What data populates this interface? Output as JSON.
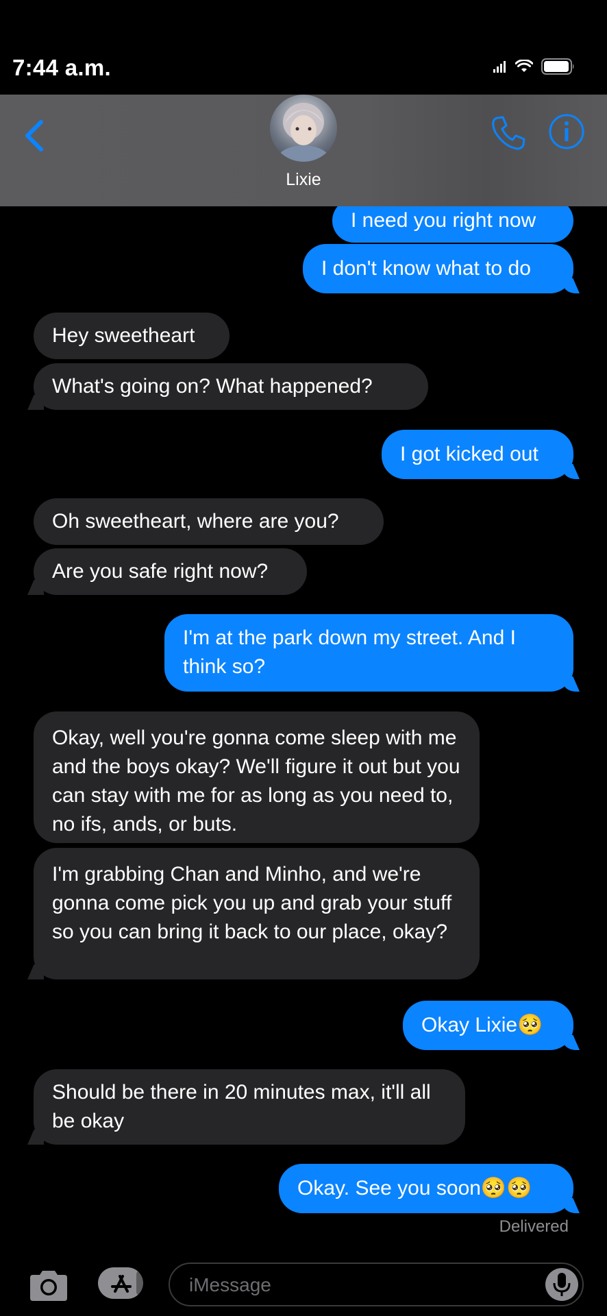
{
  "status_bar": {
    "time": "7:44 a.m."
  },
  "header": {
    "contact_name": "Lixie"
  },
  "messages": [
    {
      "text": "I need you right now"
    },
    {
      "text": "I don't know what to do"
    },
    {
      "text": "Hey sweetheart"
    },
    {
      "text": "What's going on? What happened?"
    },
    {
      "text": "I got kicked out"
    },
    {
      "text": "Oh sweetheart, where are you?"
    },
    {
      "text": "Are you safe right now?"
    },
    {
      "text": "I'm at the park down my street. And I think so?"
    },
    {
      "text": "Okay, well you're gonna come sleep with me and the boys okay? We'll figure it out but you can stay with me for as long as you need to, no ifs, ands, or buts."
    },
    {
      "text": "I'm grabbing Chan and Minho, and we're gonna come pick you up and grab your stuff so you can bring it back to our place, okay?"
    },
    {
      "text": "Okay Lixie🥺"
    },
    {
      "text": "Should be there in 20 minutes max, it'll all be okay"
    },
    {
      "text": "Okay. See you soon🥺🥺"
    }
  ],
  "delivery_status": "Delivered",
  "composer": {
    "placeholder": "iMessage"
  },
  "colors": {
    "sent_bubble": "#0b84ff",
    "received_bubble": "#262629",
    "accent": "#0b84ff",
    "background": "#000000"
  },
  "icons": [
    "back-chevron-icon",
    "phone-icon",
    "info-icon",
    "camera-icon",
    "app-store-icon",
    "microphone-icon",
    "signal-icon",
    "wifi-icon",
    "battery-icon"
  ]
}
